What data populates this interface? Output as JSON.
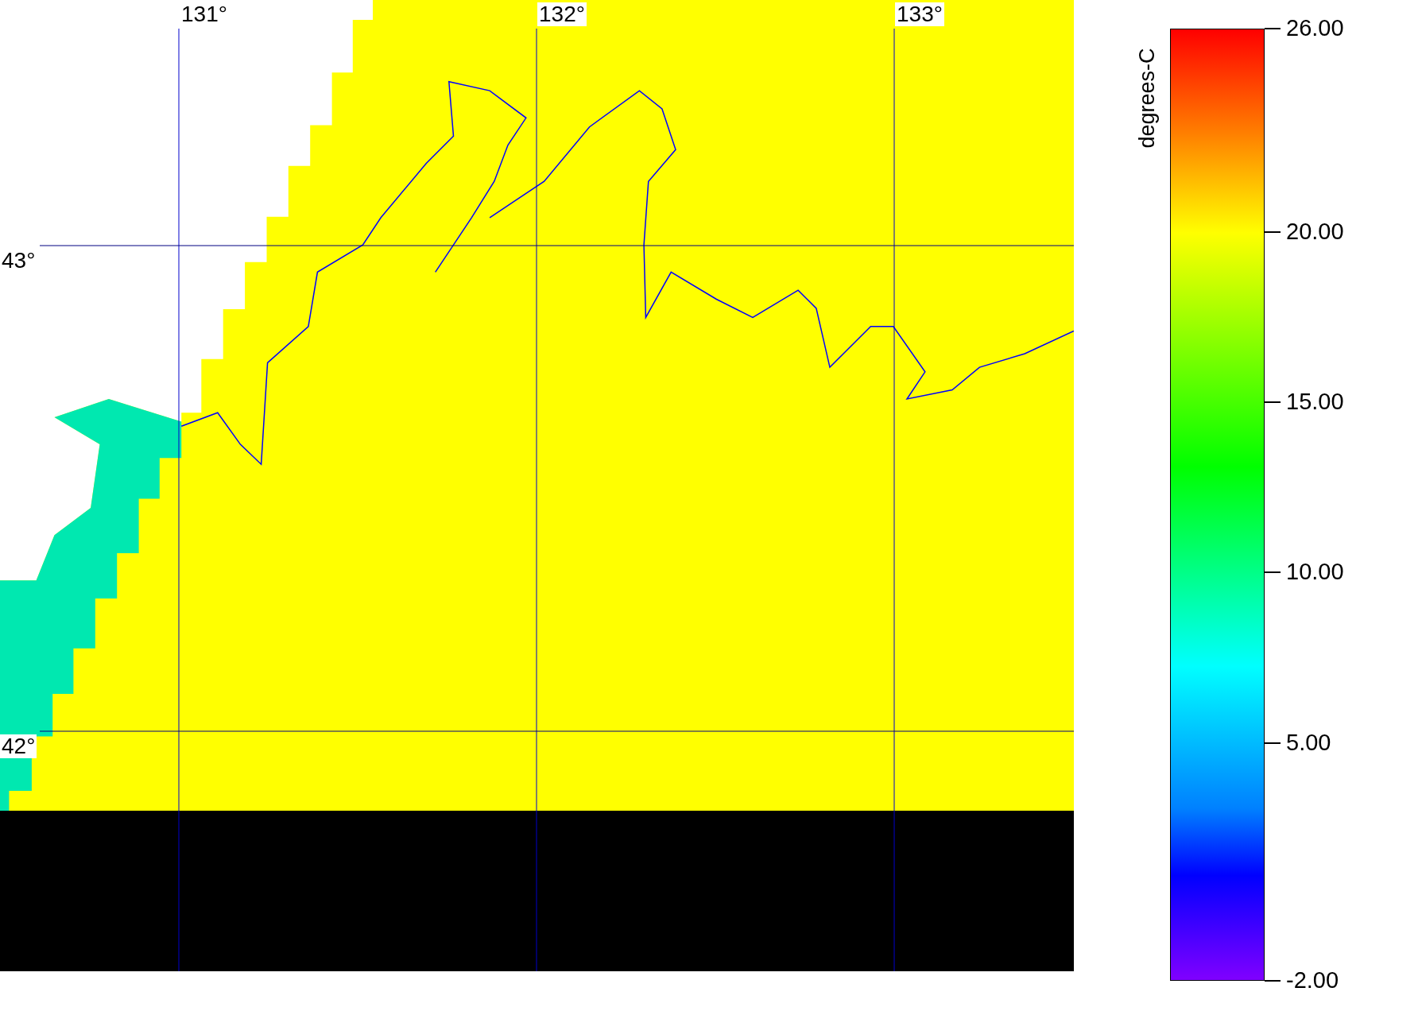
{
  "map": {
    "lon_labels": [
      "131°",
      "132°",
      "133°"
    ],
    "lat_labels": [
      "43°",
      "42°"
    ]
  },
  "colorbar": {
    "title": "degrees-C",
    "tick_labels": [
      "26.00",
      "20.00",
      "15.00",
      "10.00",
      "5.00",
      "-2.00"
    ]
  }
}
